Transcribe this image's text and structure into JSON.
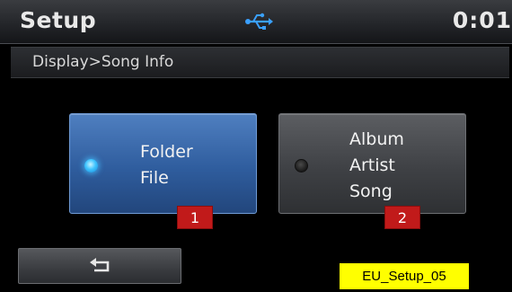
{
  "header": {
    "title": "Setup",
    "status_icon": "usb-icon",
    "clock": "0:01"
  },
  "breadcrumb": "Display>Song Info",
  "options": [
    {
      "name": "folder-file",
      "selected": true,
      "lines": [
        "Folder",
        "File"
      ],
      "callout": "1"
    },
    {
      "name": "album-artist-song",
      "selected": false,
      "lines": [
        "Album",
        "Artist",
        "Song"
      ],
      "callout": "2"
    }
  ],
  "back_button": {
    "icon": "back-arrow-icon"
  },
  "screen_code": "EU_Setup_05",
  "colors": {
    "selected_option": "#2f5d9e",
    "unselected_option": "#3f4145",
    "radio_on": "#3fc4ff",
    "callout": "#c11a1a",
    "screen_code_bg": "#ffff00"
  }
}
